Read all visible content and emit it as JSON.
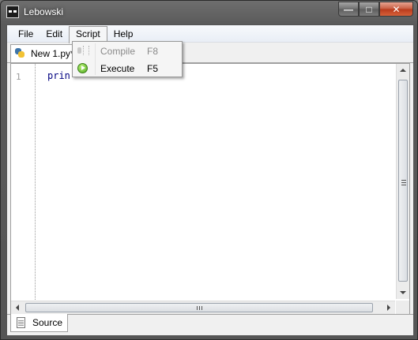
{
  "window": {
    "title": "Lebowski"
  },
  "menubar": {
    "items": [
      "File",
      "Edit",
      "Script",
      "Help"
    ]
  },
  "tabs": {
    "active_label": "New 1.py*"
  },
  "editor": {
    "line_numbers": [
      "1"
    ],
    "code_visible": "prin"
  },
  "script_menu": {
    "items": [
      {
        "label": "Compile",
        "shortcut": "F8",
        "enabled": false,
        "icon": "compile-icon"
      },
      {
        "label": "Execute",
        "shortcut": "F5",
        "enabled": true,
        "icon": "execute-icon"
      }
    ]
  },
  "bottom_tabs": {
    "source_label": "Source"
  },
  "colors": {
    "code_keyword": "#000080",
    "menu_disabled": "#8a8a8a"
  }
}
